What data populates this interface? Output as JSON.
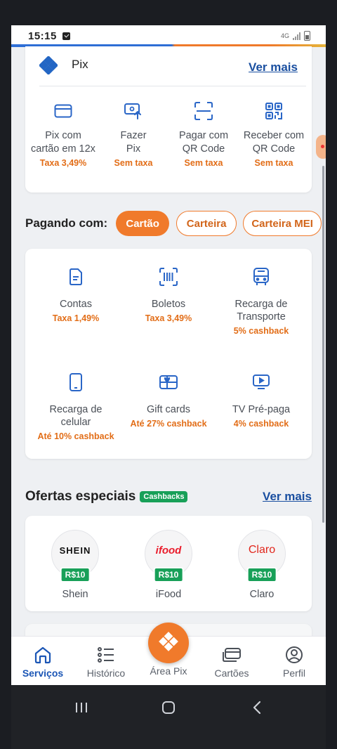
{
  "status_bar": {
    "time": "15:15",
    "network": "4G"
  },
  "pix": {
    "title": "Pix",
    "more_label": "Ver mais",
    "actions": [
      {
        "icon": "card-icon",
        "label_line1": "Pix com",
        "label_line2": "cartão em 12x",
        "note": "Taxa 3,49%"
      },
      {
        "icon": "send-pix-icon",
        "label_line1": "Fazer",
        "label_line2": "Pix",
        "note": "Sem taxa"
      },
      {
        "icon": "qr-scan-icon",
        "label_line1": "Pagar com",
        "label_line2": "QR Code",
        "note": "Sem taxa"
      },
      {
        "icon": "qr-code-icon",
        "label_line1": "Receber com",
        "label_line2": "QR Code",
        "note": "Sem taxa"
      }
    ]
  },
  "paying": {
    "label": "Pagando com:",
    "options": [
      "Cartão",
      "Carteira",
      "Carteira MEI"
    ],
    "selected": "Cartão"
  },
  "services": [
    {
      "icon": "bill-icon",
      "label_line1": "Contas",
      "label_line2": "",
      "note": "Taxa 1,49%"
    },
    {
      "icon": "barcode-icon",
      "label_line1": "Boletos",
      "label_line2": "",
      "note": "Taxa 3,49%"
    },
    {
      "icon": "bus-icon",
      "label_line1": "Recarga de",
      "label_line2": "Transporte",
      "note": "5% cashback"
    },
    {
      "icon": "phone-icon",
      "label_line1": "Recarga de",
      "label_line2": "celular",
      "note": "Até 10% cashback"
    },
    {
      "icon": "gift-card-icon",
      "label_line1": "Gift cards",
      "label_line2": "",
      "note": "Até 27% cashback"
    },
    {
      "icon": "tv-icon",
      "label_line1": "TV Pré-paga",
      "label_line2": "",
      "note": "4% cashback"
    }
  ],
  "offers": {
    "title": "Ofertas especiais",
    "badge": "Cashbacks",
    "more_label": "Ver mais",
    "items": [
      {
        "logo": "SHEIN",
        "price": "R$10",
        "name": "Shein",
        "color": "#111111"
      },
      {
        "logo": "ifood",
        "price": "R$10",
        "name": "iFood",
        "color": "#ea1d2c"
      },
      {
        "logo": "Claro",
        "price": "R$10",
        "name": "Claro",
        "color": "#e1261c"
      }
    ]
  },
  "bottom_nav": {
    "items": [
      {
        "icon": "home-icon",
        "label": "Serviços",
        "active": true
      },
      {
        "icon": "list-icon",
        "label": "Histórico",
        "active": false
      },
      {
        "icon": "pix-icon",
        "label": "Área Pix",
        "active": false
      },
      {
        "icon": "cards-icon",
        "label": "Cartões",
        "active": false
      },
      {
        "icon": "profile-icon",
        "label": "Perfil",
        "active": false
      }
    ]
  },
  "colors": {
    "accent": "#f07a2b",
    "link": "#1a4fa0",
    "green": "#18a058",
    "nav_active": "#1a55b5"
  }
}
